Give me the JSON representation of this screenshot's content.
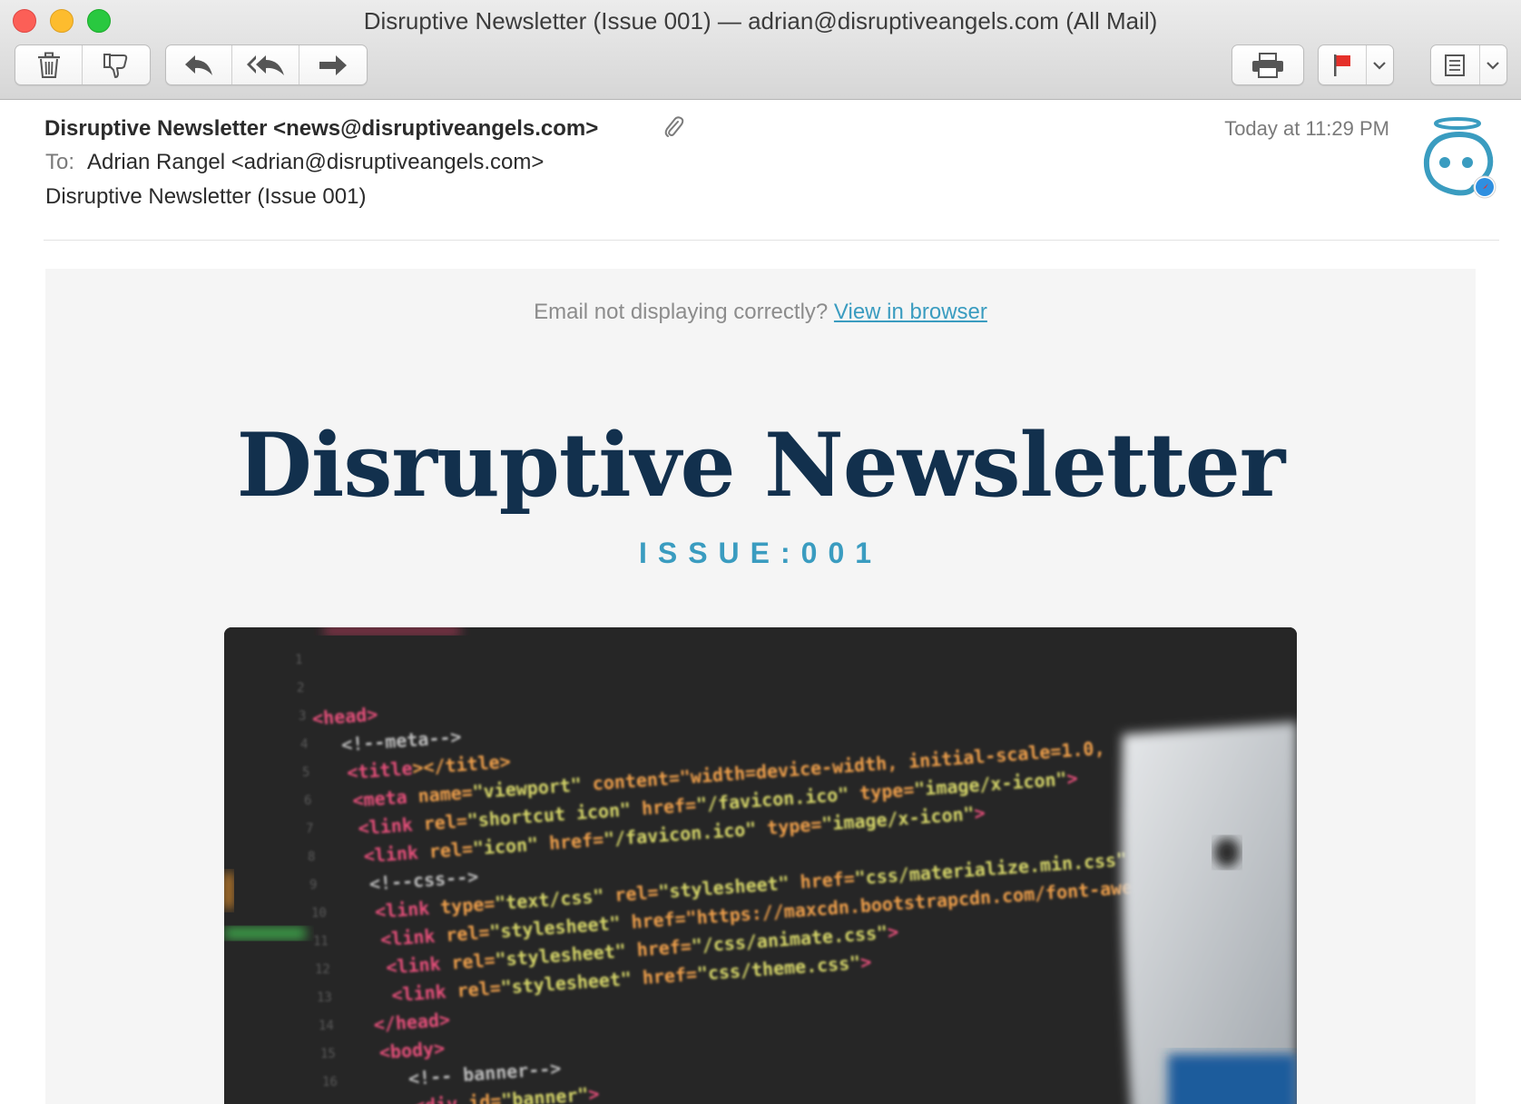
{
  "window": {
    "title": "Disruptive Newsletter (Issue 001) — adrian@disruptiveangels.com (All Mail)"
  },
  "toolbar": {
    "icons": [
      "trash-icon",
      "junk-icon",
      "reply-icon",
      "reply-all-icon",
      "forward-icon",
      "print-icon",
      "flag-icon",
      "chevron-down-icon",
      "list-icon",
      "chevron-down-icon"
    ],
    "flag_color": "#e5302a"
  },
  "message": {
    "from": "Disruptive Newsletter <news@disruptiveangels.com>",
    "to_label": "To:",
    "to": "Adrian Rangel <adrian@disruptiveangels.com>",
    "subject": "Disruptive Newsletter (Issue 001)",
    "date": "Today at 11:29 PM"
  },
  "email": {
    "notice_text": "Email not displaying correctly?",
    "notice_link": "View in browser",
    "title": "Disruptive Newsletter",
    "issue": "ISSUE:001",
    "colors": {
      "title": "#12304d",
      "accent": "#3a9cc0",
      "background": "#f5f5f5"
    },
    "hero_code": {
      "line_numbers": [
        "1",
        "2",
        "3",
        "4",
        "5",
        "6",
        "7",
        "8",
        "9",
        "10",
        "11",
        "12",
        "13",
        "14",
        "15",
        "16"
      ],
      "lines": [
        "<head>",
        "<!--meta-->",
        "<title></title>",
        "<meta name=\"viewport\" content=\"width=device-width, initial-scale=1.0,",
        "<link rel=\"shortcut icon\" href=\"/favicon.ico\" type=\"image/x-icon\">",
        "<link rel=\"icon\" href=\"/favicon.ico\" type=\"image/x-icon\">",
        "<!--css-->",
        "<link type=\"text/css\" rel=\"stylesheet\" href=\"css/materialize.min.css\"",
        "<link rel=\"stylesheet\" href=\"https://maxcdn.bootstrapcdn.com/font-awesome",
        "<link rel=\"stylesheet\" href=\"/css/animate.css\">",
        "<link rel=\"stylesheet\" href=\"css/theme.css\">",
        "</head>",
        "<body>",
        "<!-- banner-->",
        "<div id=\"banner\">"
      ]
    }
  }
}
